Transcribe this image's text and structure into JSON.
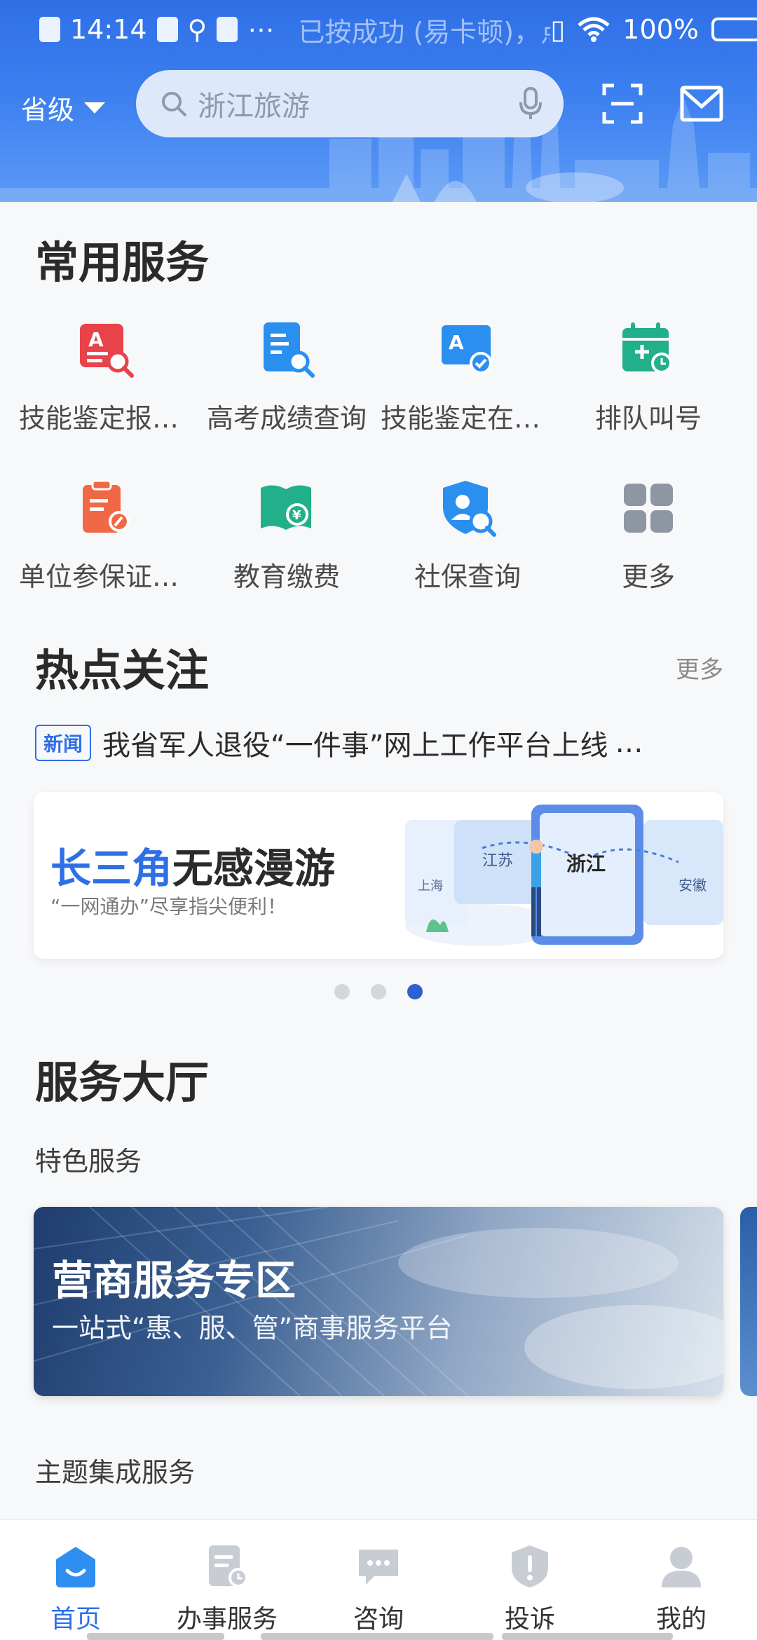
{
  "status_bar": {
    "time": "14:14",
    "notice": "已按成功 (易卡顿)，点击查看",
    "battery": "100%",
    "battery_level": 1.0
  },
  "header": {
    "region_label": "省级",
    "search_placeholder": "浙江旅游",
    "icons": [
      "scan-icon",
      "mail-icon",
      "mic-icon",
      "search-icon"
    ]
  },
  "common_services": {
    "title": "常用服务",
    "items": [
      {
        "label": "技能鉴定报名查询",
        "icon": "skill-exam-search-icon",
        "color": "#e8424a"
      },
      {
        "label": "高考成绩查询",
        "icon": "doc-search-icon",
        "color": "#2b8ff0"
      },
      {
        "label": "技能鉴定在线报名",
        "icon": "skill-check-icon",
        "color": "#2b8ff0"
      },
      {
        "label": "排队叫号",
        "icon": "calendar-clock-icon",
        "color": "#22b08a"
      },
      {
        "label": "单位参保证明打印",
        "icon": "clipboard-edit-icon",
        "color": "#f06845"
      },
      {
        "label": "教育缴费",
        "icon": "book-yuan-icon",
        "color": "#22b08a"
      },
      {
        "label": "社保查询",
        "icon": "shield-user-icon",
        "color": "#2b8ff0"
      },
      {
        "label": "更多",
        "icon": "grid-more-icon",
        "color": "#8f96a3"
      }
    ]
  },
  "hot_topics": {
    "title": "热点关注",
    "more": "更多",
    "news_tag": "新闻",
    "news_text": "我省军人退役“一件事”网上工作平台上线",
    "banner": {
      "title_part1": "长三角",
      "title_part2": "无感漫游",
      "subtitle": "“一网通办”尽享指尖便利！",
      "map_labels": [
        "上海",
        "江苏",
        "浙江",
        "安徽"
      ]
    },
    "carousel": {
      "count": 3,
      "active": 3
    }
  },
  "service_hall": {
    "title": "服务大厅",
    "featured_label": "特色服务",
    "feature_card": {
      "title": "营商服务专区",
      "subtitle": "一站式“惠、服、管”商事服务平台"
    },
    "themed_label": "主题集成服务"
  },
  "bottom_nav": {
    "items": [
      {
        "label": "首页",
        "icon": "home-icon",
        "active": true
      },
      {
        "label": "办事服务",
        "icon": "document-clock-icon",
        "active": false
      },
      {
        "label": "咨询",
        "icon": "chat-bubble-icon",
        "active": false
      },
      {
        "label": "投诉",
        "icon": "shield-alert-icon",
        "active": false
      },
      {
        "label": "我的",
        "icon": "user-icon",
        "active": false
      }
    ],
    "active_color": "#2f6fe6"
  }
}
